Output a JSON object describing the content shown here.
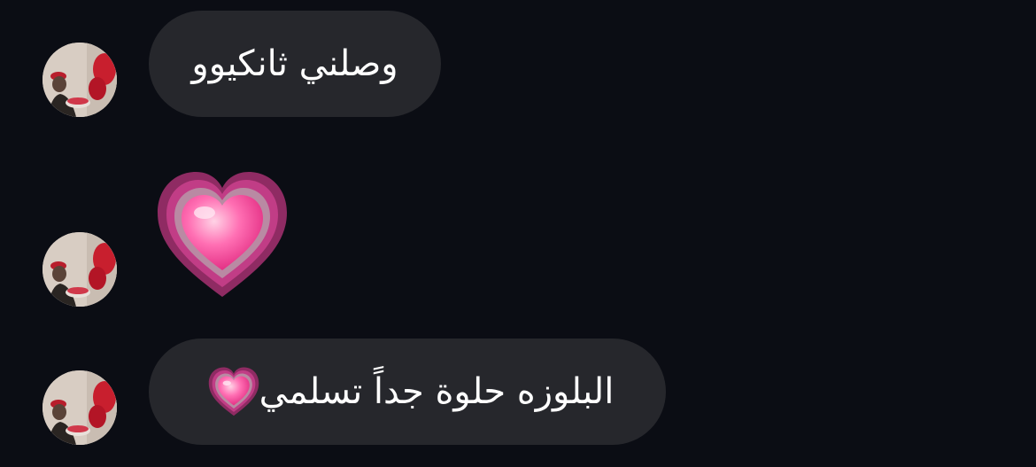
{
  "conversation": {
    "messages": [
      {
        "text": "وصلني ثانكيوو",
        "type": "text"
      },
      {
        "emoji": "growing-heart",
        "type": "emoji"
      },
      {
        "text": "البلوزه حلوة جداً تسلمي",
        "emoji": "growing-heart",
        "type": "text"
      }
    ]
  },
  "colors": {
    "background": "#0b0d14",
    "bubble": "#26272c",
    "text": "#ffffff",
    "heart": "#ec407a"
  }
}
